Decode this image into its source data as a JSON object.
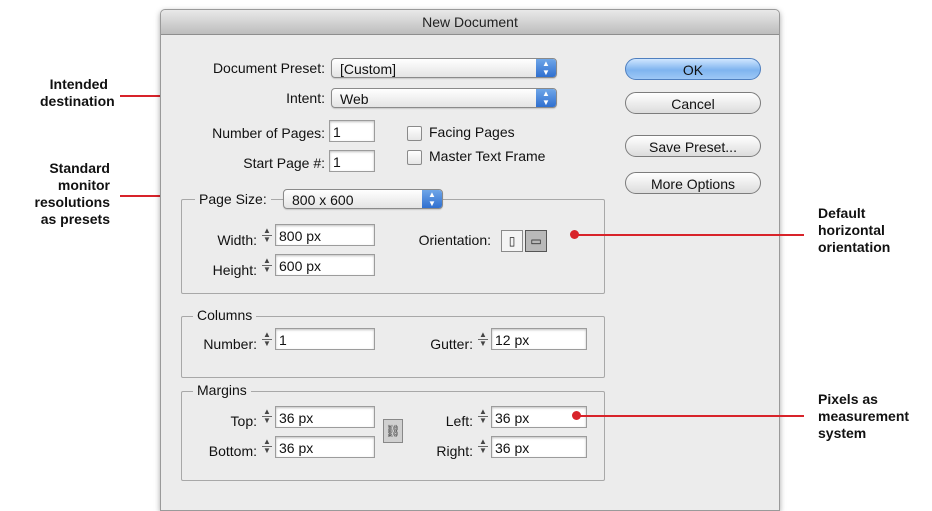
{
  "dialog": {
    "title": "New Document",
    "preset": {
      "label": "Document Preset:",
      "value": "[Custom]"
    },
    "intent": {
      "label": "Intent:",
      "value": "Web"
    },
    "num_pages": {
      "label": "Number of Pages:",
      "value": "1"
    },
    "start_page": {
      "label": "Start Page #:",
      "value": "1"
    },
    "facing_pages": {
      "label": "Facing Pages",
      "checked": false
    },
    "master_text_frame": {
      "label": "Master Text Frame",
      "checked": false
    },
    "page_size": {
      "label": "Page Size:",
      "value": "800 x 600"
    },
    "width": {
      "label": "Width:",
      "value": "800 px"
    },
    "height": {
      "label": "Height:",
      "value": "600 px"
    },
    "orientation": {
      "label": "Orientation:",
      "selected": "landscape"
    },
    "columns": {
      "title": "Columns",
      "number": {
        "label": "Number:",
        "value": "1"
      },
      "gutter": {
        "label": "Gutter:",
        "value": "12 px"
      }
    },
    "margins": {
      "title": "Margins",
      "top": {
        "label": "Top:",
        "value": "36 px"
      },
      "bottom": {
        "label": "Bottom:",
        "value": "36 px"
      },
      "left": {
        "label": "Left:",
        "value": "36 px"
      },
      "right": {
        "label": "Right:",
        "value": "36 px"
      }
    },
    "buttons": {
      "ok": "OK",
      "cancel": "Cancel",
      "save_preset": "Save Preset...",
      "more_options": "More Options"
    }
  },
  "annotations": {
    "intent_l1": "Intended",
    "intent_l2": "destination",
    "size_l1": "Standard",
    "size_l2": "monitor",
    "size_l3": "resolutions",
    "size_l4": "as presets",
    "orient_l1": "Default",
    "orient_l2": "horizontal",
    "orient_l3": "orientation",
    "units_l1": "Pixels as",
    "units_l2": "measurement",
    "units_l3": "system"
  },
  "colors": {
    "callout": "#d8232a",
    "default_button": "#7fb4ef",
    "dialog_bg": "#ececec"
  }
}
